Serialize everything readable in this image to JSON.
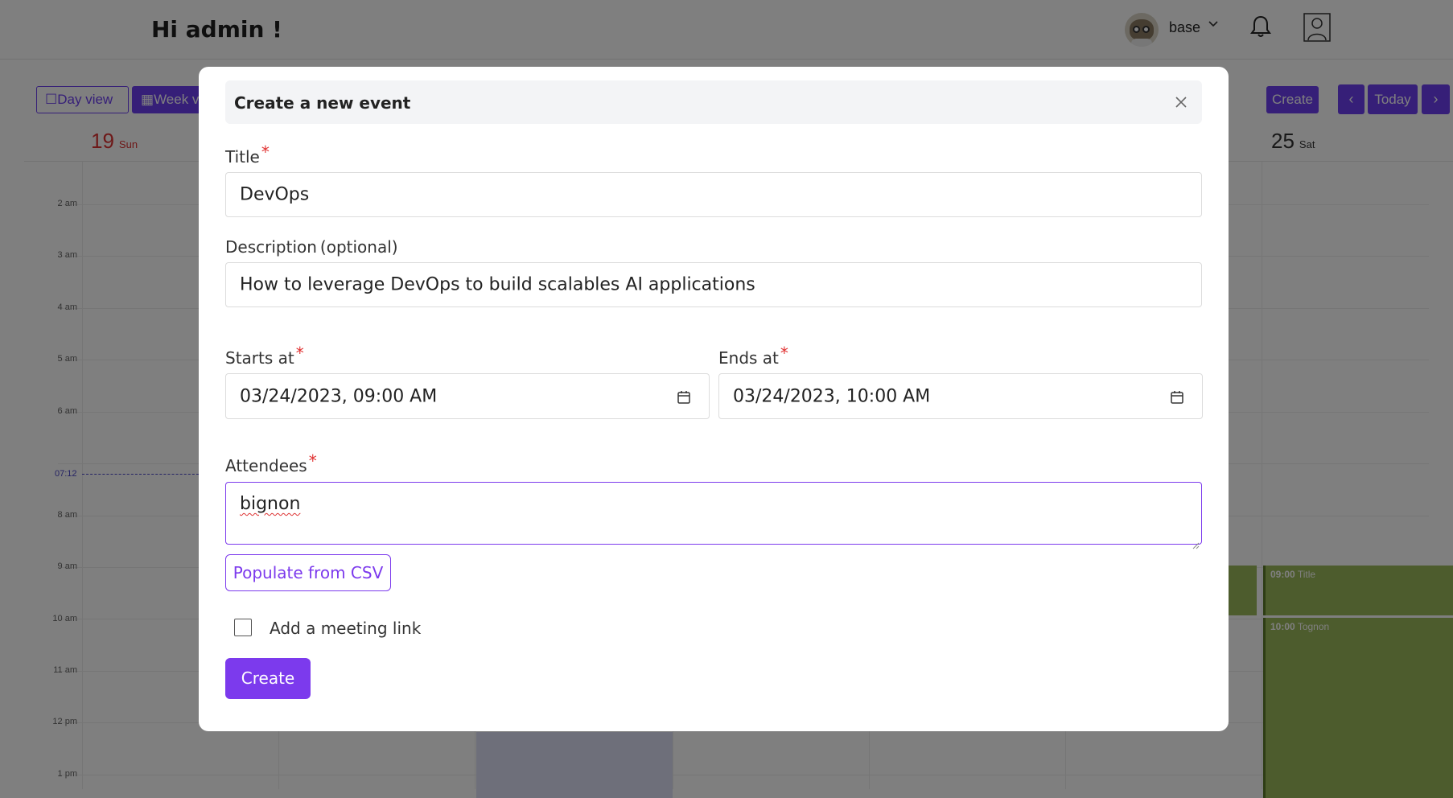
{
  "header": {
    "greeting": "Hi admin !",
    "user_name": "base"
  },
  "toolbar": {
    "day_view_label": "Day view",
    "week_view_label": "Week v",
    "create_label": "Create",
    "today_label": "Today"
  },
  "calendar": {
    "days": [
      {
        "num": "19",
        "name": "Sun"
      },
      {
        "num": "25",
        "name": "Sat"
      }
    ],
    "hours": [
      "2 am",
      "3 am",
      "4 am",
      "5 am",
      "6 am",
      "8 am",
      "9 am",
      "10 am",
      "11 am",
      "12 pm",
      "1 pm"
    ],
    "now_label": "07:12",
    "events": [
      {
        "time": "09:00",
        "title": "Title"
      },
      {
        "time": "10:00",
        "title": "Tognon"
      }
    ]
  },
  "modal": {
    "title": "Create a new event",
    "title_label": "Title",
    "title_value": "DevOps",
    "description_label": "Description",
    "description_optional": "(optional)",
    "description_value": "How to leverage DevOps to build scalables AI applications",
    "starts_label": "Starts at",
    "starts_value": "03/24/2023, 09:00 AM",
    "ends_label": "Ends at",
    "ends_value": "03/24/2023, 10:00 AM",
    "attendees_label": "Attendees",
    "attendees_value": "bignon",
    "csv_button": "Populate from CSV",
    "meeting_link_label": "Add a meeting link",
    "meeting_link_checked": false,
    "create_button": "Create",
    "required_mark": "*"
  },
  "colors": {
    "accent": "#7c3aed",
    "required": "#e03131",
    "event_green": "#9ab85a"
  }
}
